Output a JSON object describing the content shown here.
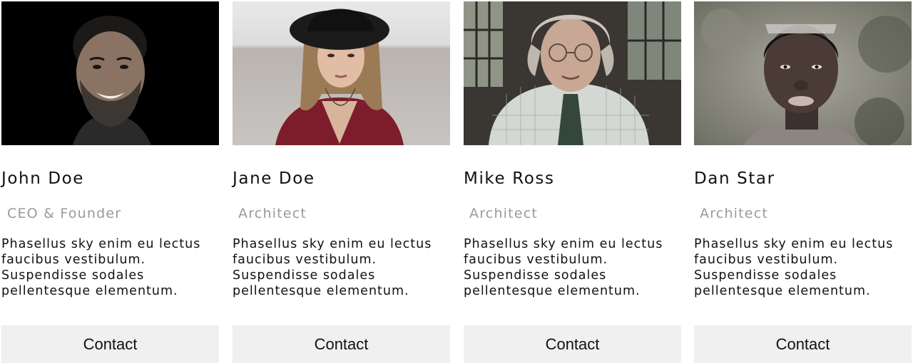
{
  "team": {
    "members": [
      {
        "name": "John Doe",
        "role": "CEO & Founder",
        "description_lines": [
          "Phasellus sky enim eu lectus",
          "faucibus vestibulum.",
          "Suspendisse sodales",
          "pellentesque elementum."
        ],
        "button_label": "Contact"
      },
      {
        "name": "Jane Doe",
        "role": "Architect",
        "description_lines": [
          "Phasellus sky enim eu lectus",
          "faucibus vestibulum.",
          "Suspendisse sodales",
          "pellentesque elementum."
        ],
        "button_label": "Contact"
      },
      {
        "name": "Mike Ross",
        "role": "Architect",
        "description_lines": [
          "Phasellus sky enim eu lectus",
          "faucibus vestibulum.",
          "Suspendisse sodales",
          "pellentesque elementum."
        ],
        "button_label": "Contact"
      },
      {
        "name": "Dan Star",
        "role": "Architect",
        "description_lines": [
          "Phasellus sky enim eu lectus",
          "faucibus vestibulum.",
          "Suspendisse sodales",
          "pellentesque elementum."
        ],
        "button_label": "Contact"
      }
    ]
  },
  "colors": {
    "text": "#111111",
    "role_text": "#9a9a9a",
    "button_bg": "#f0f0f0",
    "background": "#ffffff"
  }
}
